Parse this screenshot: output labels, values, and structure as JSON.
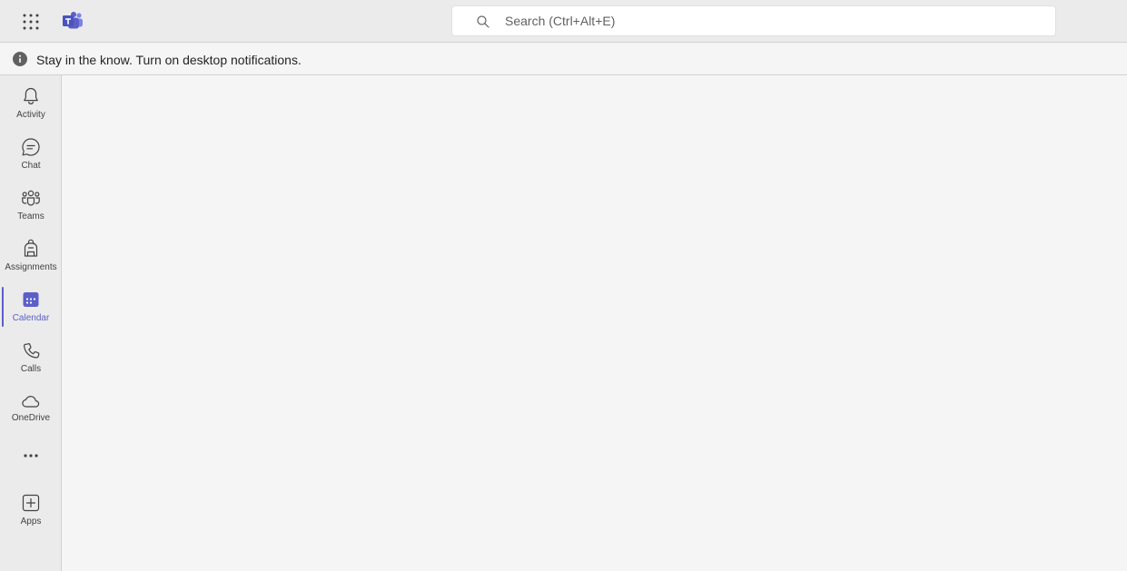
{
  "app": {
    "brand_color": "#5b5fc7",
    "icons": {
      "launcher": "app-launcher-icon",
      "logo": "teams-logo-icon"
    }
  },
  "search": {
    "placeholder": "Search (Ctrl+Alt+E)",
    "value": ""
  },
  "notification": {
    "text": "Stay in the know. Turn on desktop notifications."
  },
  "rail": {
    "active": "Calendar",
    "items": [
      {
        "label": "Activity",
        "icon": "bell-icon"
      },
      {
        "label": "Chat",
        "icon": "chat-icon"
      },
      {
        "label": "Teams",
        "icon": "people-icon"
      },
      {
        "label": "Assignments",
        "icon": "backpack-icon"
      },
      {
        "label": "Calendar",
        "icon": "calendar-icon"
      },
      {
        "label": "Calls",
        "icon": "phone-icon"
      },
      {
        "label": "OneDrive",
        "icon": "cloud-icon"
      }
    ],
    "more_icon": "more-icon",
    "apps": {
      "label": "Apps",
      "icon": "add-apps-icon"
    }
  }
}
